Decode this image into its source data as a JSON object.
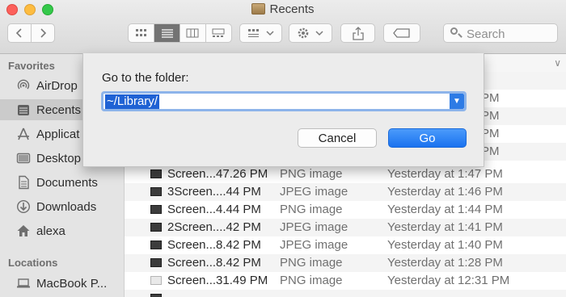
{
  "window": {
    "title": "Recents"
  },
  "toolbar": {
    "back_icon": "chevron-left-icon",
    "forward_icon": "chevron-right-icon",
    "view_modes": [
      "icon-view",
      "list-view",
      "column-view",
      "gallery-view"
    ],
    "active_view": "list-view",
    "search_placeholder": "Search"
  },
  "sidebar": {
    "favorites_heading": "Favorites",
    "items": [
      {
        "label": "AirDrop",
        "icon": "airdrop-icon"
      },
      {
        "label": "Recents",
        "icon": "recents-icon",
        "selected": true
      },
      {
        "label": "Applicat",
        "icon": "applications-icon"
      },
      {
        "label": "Desktop",
        "icon": "desktop-icon"
      },
      {
        "label": "Documents",
        "icon": "documents-icon"
      },
      {
        "label": "Downloads",
        "icon": "downloads-icon"
      },
      {
        "label": "alexa",
        "icon": "home-icon"
      }
    ],
    "locations_heading": "Locations",
    "locations": [
      {
        "label": "MacBook P...",
        "icon": "laptop-icon"
      }
    ]
  },
  "file_list": {
    "hidden_dates": [
      "PM",
      "PM",
      "PM",
      "PM"
    ],
    "rows": [
      {
        "name": "Screen...47.26 PM",
        "kind": "PNG image",
        "date": "Yesterday at 1:47 PM"
      },
      {
        "name": "3Screen....44 PM",
        "kind": "JPEG image",
        "date": "Yesterday at 1:46 PM"
      },
      {
        "name": "Screen...4.44 PM",
        "kind": "PNG image",
        "date": "Yesterday at 1:44 PM"
      },
      {
        "name": "2Screen....42 PM",
        "kind": "JPEG image",
        "date": "Yesterday at 1:41 PM"
      },
      {
        "name": "Screen...8.42 PM",
        "kind": "JPEG image",
        "date": "Yesterday at 1:40 PM"
      },
      {
        "name": "Screen...8.42 PM",
        "kind": "PNG image",
        "date": "Yesterday at 1:28 PM"
      },
      {
        "name": "Screen...31.49 PM",
        "kind": "PNG image",
        "date": "Yesterday at 12:31 PM"
      }
    ]
  },
  "goto_sheet": {
    "label": "Go to the folder:",
    "path_value": "~/Library/",
    "cancel_label": "Cancel",
    "go_label": "Go"
  }
}
